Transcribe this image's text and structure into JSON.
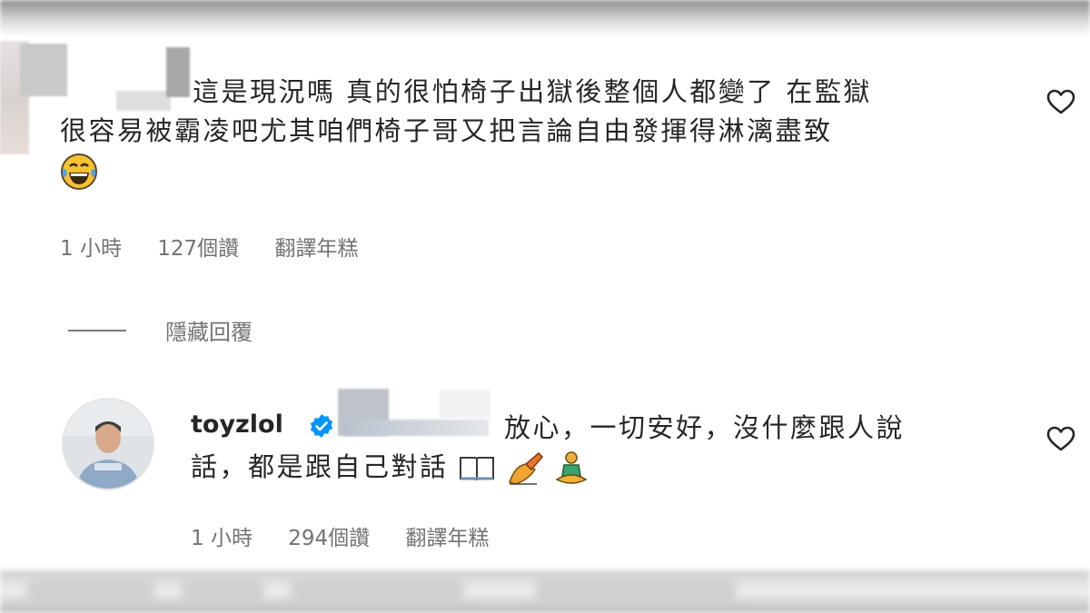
{
  "comment1": {
    "text_line1": "這是現況嗎 真的很怕椅子出獄後整個人都變了 在監獄",
    "text_line2": "很容易被霸凌吧尤其咱們椅子哥又把言論自由發揮得淋漓盡致",
    "emoji": "😂",
    "time": "1 小時",
    "likes": "127個讚",
    "translate": "翻譯年糕",
    "like_icon": "heart-icon"
  },
  "hide_replies": {
    "label": "隱藏回覆"
  },
  "reply": {
    "username": "toyzlol",
    "verified_icon": "verified-badge-icon",
    "text_line1": "放心，一切安好，沒什麼跟人說",
    "text_line2": "話，都是跟自己對話",
    "emojis": [
      "📖",
      "✍",
      "🧘"
    ],
    "time": "1 小時",
    "likes": "294個讚",
    "translate": "翻譯年糕",
    "like_icon": "heart-icon"
  },
  "colors": {
    "text": "#262626",
    "meta": "#737373",
    "verified": "#0095f6"
  }
}
